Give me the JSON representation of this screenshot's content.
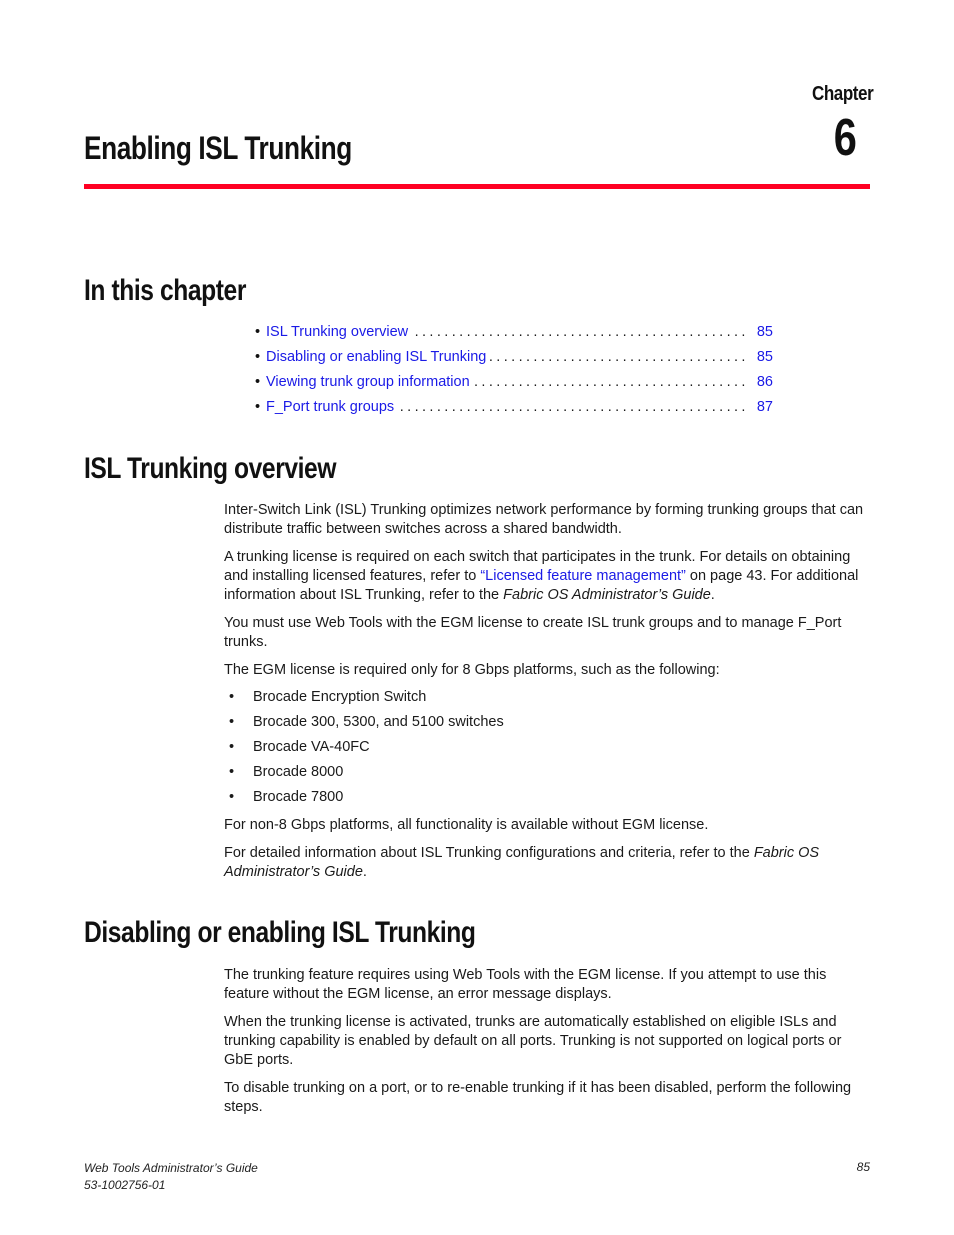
{
  "header": {
    "chapter_label": "Chapter",
    "chapter_number": "6",
    "chapter_title": "Enabling ISL Trunking",
    "rule_color": "#ff0022"
  },
  "in_this_chapter": {
    "heading": "In this chapter",
    "toc": [
      {
        "label": "ISL Trunking overview",
        "page": "85"
      },
      {
        "label": "Disabling or enabling ISL Trunking",
        "page": "85"
      },
      {
        "label": "Viewing trunk group information",
        "page": "86"
      },
      {
        "label": "F_Port trunk groups",
        "page": "87"
      }
    ],
    "link_color": "#1a1ae6"
  },
  "overview": {
    "heading": "ISL Trunking overview",
    "p1": "Inter-Switch Link (ISL) Trunking optimizes network performance by forming trunking groups that can distribute traffic between switches across a shared bandwidth.",
    "p2_before": "A trunking license is required on each switch that participates in the trunk. For details on obtaining and installing licensed features, refer to ",
    "p2_link": "“Licensed feature management”",
    "p2_after": " on page 43. For additional information about ISL Trunking, refer to the ",
    "p2_italic": "Fabric OS Administrator’s Guide",
    "p2_end": ".",
    "p3": "You must use Web Tools with the EGM license to create ISL trunk groups and to manage F_Port trunks.",
    "p4": "The EGM license is required only for 8 Gbps platforms, such as the following:",
    "platforms": [
      "Brocade Encryption Switch",
      "Brocade 300, 5300, and 5100 switches",
      "Brocade VA-40FC",
      "Brocade 8000",
      "Brocade 7800"
    ],
    "p5": "For non-8 Gbps platforms, all functionality is available without EGM license.",
    "p6_before": "For detailed information about ISL Trunking configurations and criteria, refer to the ",
    "p6_italic": "Fabric OS Administrator’s Guide",
    "p6_end": "."
  },
  "disabling": {
    "heading": "Disabling or enabling ISL Trunking",
    "p1": "The trunking feature requires using Web Tools with the EGM license. If you attempt to use this feature without the EGM license, an error message displays.",
    "p2": "When the trunking license is activated, trunks are automatically established on eligible ISLs and trunking capability is enabled by default on all ports. Trunking is not supported on logical ports or GbE ports.",
    "p3": "To disable trunking on a port, or to re-enable trunking if it has been disabled, perform the following steps."
  },
  "footer": {
    "guide_title": "Web Tools Administrator’s Guide",
    "doc_number": "53-1002756-01",
    "page_number": "85"
  }
}
